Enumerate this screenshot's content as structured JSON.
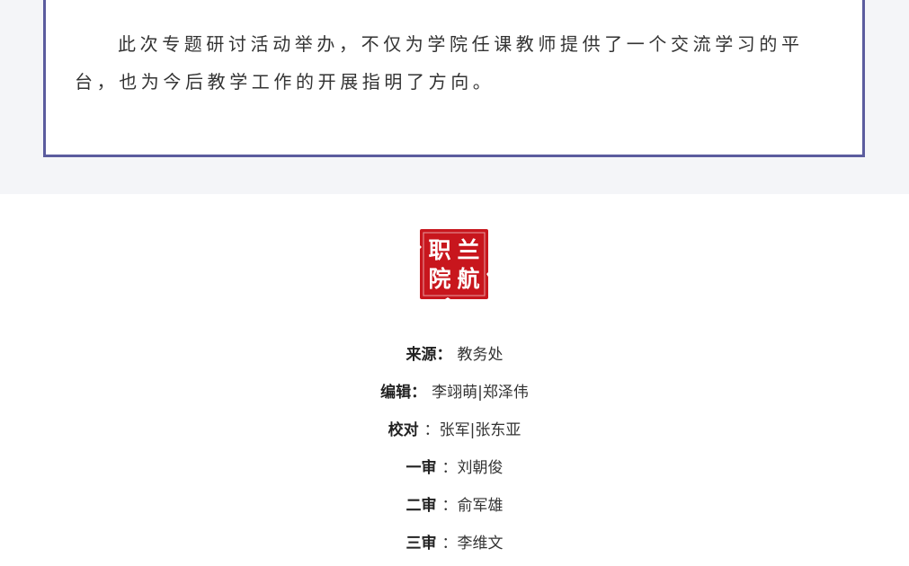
{
  "article": {
    "paragraph": "此次专题研讨活动举办，不仅为学院任课教师提供了一个交流学习的平台，也为今后教学工作的开展指明了方向。"
  },
  "seal": {
    "characters": [
      "职",
      "院",
      "兰",
      "航"
    ],
    "icon": "college-seal-stamp",
    "color": "#c8161d"
  },
  "credits": [
    {
      "label": "来源：",
      "value": "教务处"
    },
    {
      "label": "编辑：",
      "value": "李翊萌|郑泽伟"
    },
    {
      "label": "校对",
      "value": "：张军|张东亚"
    },
    {
      "label": "一审",
      "value": "：刘朝俊"
    },
    {
      "label": "二审",
      "value": "：俞军雄"
    },
    {
      "label": "三审",
      "value": "：李维文"
    }
  ],
  "colors": {
    "border": "#5b5c9e",
    "top_background": "#f4f5f8",
    "text": "#333333"
  }
}
